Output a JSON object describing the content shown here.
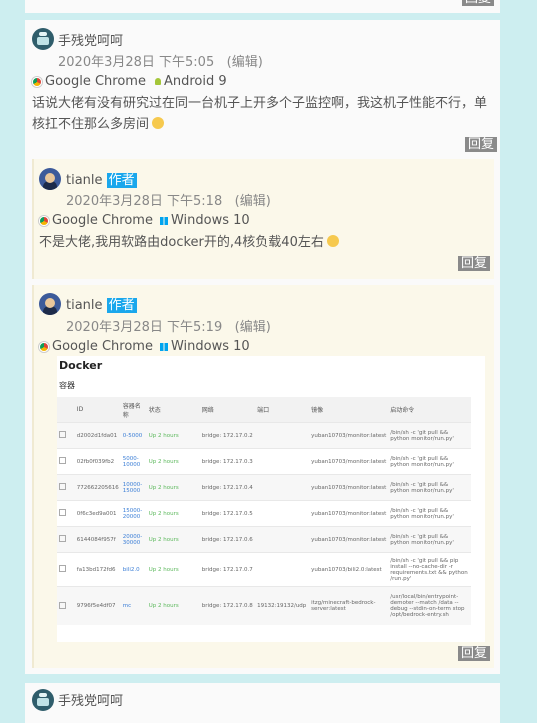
{
  "top_reply_label": "回复",
  "comment": {
    "author": "手残党呵呵",
    "date": "2020年3月28日 下午5:05",
    "edit": "(编辑)",
    "browser": "Google Chrome",
    "os": "Android 9",
    "text": "话说大佬有没有研究过在同一台机子上开多个子监控啊，我这机子性能不行，单核扛不住那么多房间",
    "reply_label": "回复"
  },
  "replies": [
    {
      "author": "tianle",
      "badge": "作者",
      "date": "2020年3月28日 下午5:18",
      "edit": "(编辑)",
      "browser": "Google Chrome",
      "os": "Windows 10",
      "text": "不是大佬,我用软路由docker开的,4核负载40左右",
      "reply_label": "回复"
    },
    {
      "author": "tianle",
      "badge": "作者",
      "date": "2020年3月28日 下午5:19",
      "edit": "(编辑)",
      "browser": "Google Chrome",
      "os": "Windows 10",
      "reply_label": "回复"
    }
  ],
  "docker": {
    "title": "Docker",
    "subtitle": "容器",
    "headers": [
      "",
      "ID",
      "容器名称",
      "状态",
      "网络",
      "端口",
      "镜像",
      "启动命令"
    ],
    "rows": [
      [
        "d2002d1fda01",
        "0-5000",
        "Up 2 hours",
        "bridge: 172.17.0.2",
        "",
        "yuban10703/monitor:latest",
        "/bin/sh -c 'git pull && python monitor/run.py'"
      ],
      [
        "02fb0f039fb2",
        "5000-10000",
        "Up 2 hours",
        "bridge: 172.17.0.3",
        "",
        "yuban10703/monitor:latest",
        "/bin/sh -c 'git pull && python monitor/run.py'"
      ],
      [
        "772662205616",
        "10000-15000",
        "Up 2 hours",
        "bridge: 172.17.0.4",
        "",
        "yuban10703/monitor:latest",
        "/bin/sh -c 'git pull && python monitor/run.py'"
      ],
      [
        "0f6c3ed9a001",
        "15000-20000",
        "Up 2 hours",
        "bridge: 172.17.0.5",
        "",
        "yuban10703/monitor:latest",
        "/bin/sh -c 'git pull && python monitor/run.py'"
      ],
      [
        "6144084f957f",
        "20000-30000",
        "Up 2 hours",
        "bridge: 172.17.0.6",
        "",
        "yuban10703/monitor:latest",
        "/bin/sh -c 'git pull && python monitor/run.py'"
      ],
      [
        "fa13bd172fd6",
        "bili2.0",
        "Up 2 hours",
        "bridge: 172.17.0.7",
        "",
        "yuban10703/bili2.0:latest",
        "/bin/sh -c 'git pull && pip install --no-cache-dir -r requirements.txt && python /run.py'"
      ],
      [
        "9796f5e4df07",
        "mc",
        "Up 2 hours",
        "bridge: 172.17.0.8",
        "19132:19132/udp",
        "itzg/minecraft-bedrock-server:latest",
        "/usr/local/bin/entrypoint-demoter --match /data --debug --stdin-on-term stop /opt/bedrock-entry.sh"
      ]
    ]
  },
  "bottom_author": "手残党呵呵"
}
